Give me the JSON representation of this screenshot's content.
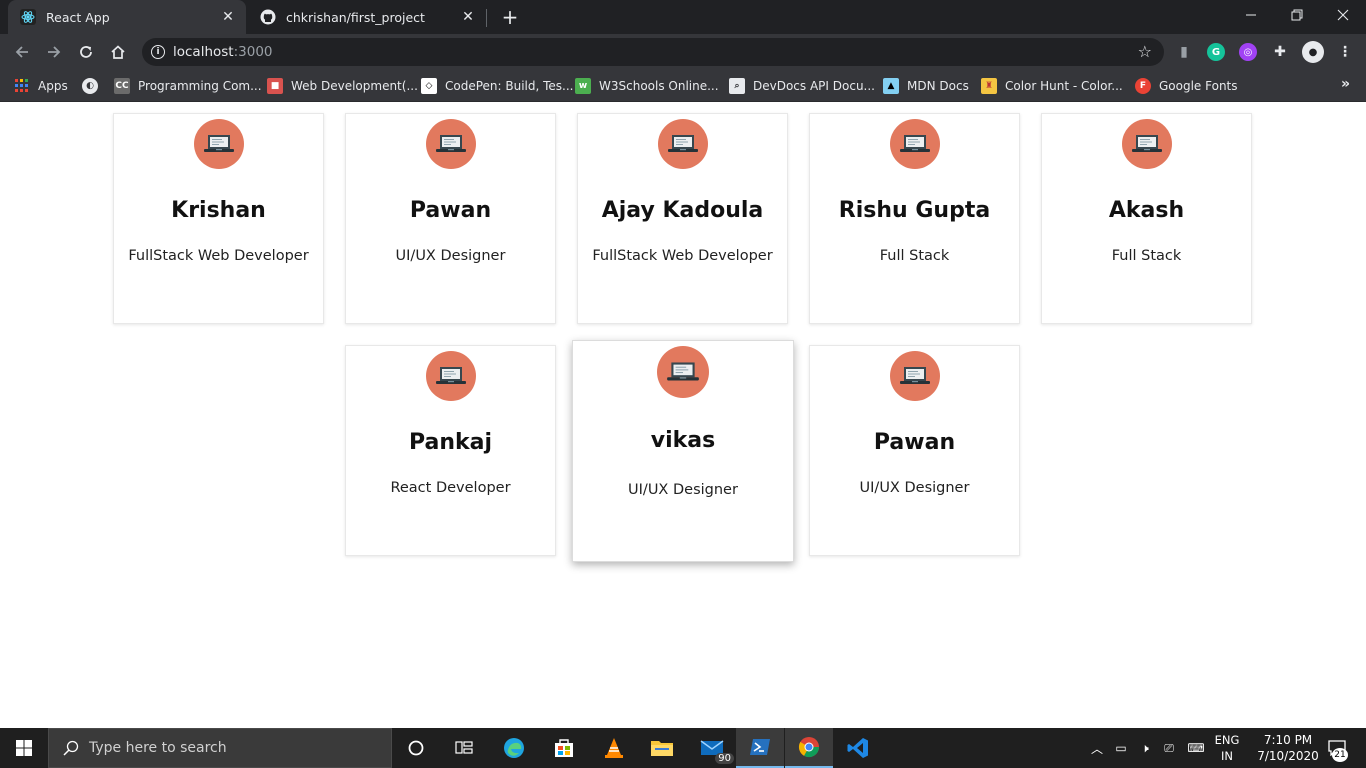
{
  "browser": {
    "tabs": [
      {
        "title": "React App",
        "icon": "react-icon",
        "active": true
      },
      {
        "title": "chkrishan/first_project",
        "icon": "github-icon",
        "active": false
      }
    ],
    "url_host": "localhost",
    "url_port": ":3000",
    "bookmarks": [
      {
        "label": "Apps",
        "icon": "apps-grid-icon"
      },
      {
        "label": "",
        "icon": "globe-icon"
      },
      {
        "label": "Programming Com...",
        "icon": "cc-icon",
        "badge": "CC"
      },
      {
        "label": "Web Development(...",
        "icon": "cube-icon"
      },
      {
        "label": "CodePen: Build, Tes...",
        "icon": "codepen-icon"
      },
      {
        "label": "W3Schools Online...",
        "icon": "w3schools-icon"
      },
      {
        "label": "DevDocs API Docu...",
        "icon": "devdocs-icon"
      },
      {
        "label": "MDN Docs",
        "icon": "mdn-icon"
      },
      {
        "label": "Color Hunt - Color...",
        "icon": "colorhunt-icon"
      },
      {
        "label": "Google Fonts",
        "icon": "google-fonts-icon",
        "badge": "F"
      }
    ]
  },
  "cards": [
    {
      "name": "Krishan",
      "role": "FullStack Web Developer"
    },
    {
      "name": "Pawan",
      "role": "UI/UX Designer"
    },
    {
      "name": "Ajay Kadoula",
      "role": "FullStack Web Developer"
    },
    {
      "name": "Rishu Gupta",
      "role": "Full Stack"
    },
    {
      "name": "Akash",
      "role": "Full Stack"
    },
    {
      "name": "Pankaj",
      "role": "React Developer"
    },
    {
      "name": "vikas",
      "role": "UI/UX Designer"
    },
    {
      "name": "Pawan",
      "role": "UI/UX Designer"
    }
  ],
  "taskbar": {
    "search_placeholder": "Type here to search",
    "mail_badge": "90",
    "lang_line1": "ENG",
    "lang_line2": "IN",
    "time": "7:10 PM",
    "date": "7/10/2020",
    "notifications": "21"
  },
  "colors": {
    "avatar": "#e2795e",
    "chrome_dark": "#202124",
    "chrome_toolbar": "#35363a",
    "taskbar": "#1f1f1f"
  }
}
